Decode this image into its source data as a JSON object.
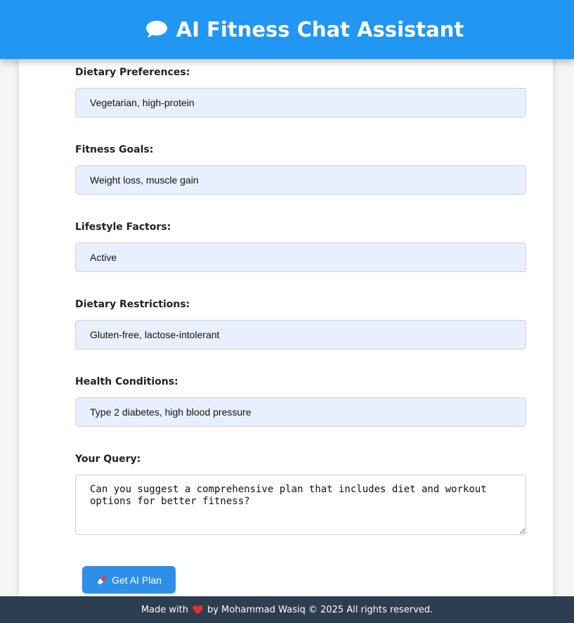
{
  "header": {
    "title": "AI Fitness Chat Assistant",
    "icon": "speech-bubble-icon",
    "background": "#2196f3"
  },
  "form": {
    "fields": [
      {
        "label": "Dietary Preferences:",
        "value": "Vegetarian, high-protein"
      },
      {
        "label": "Fitness Goals:",
        "value": "Weight loss, muscle gain"
      },
      {
        "label": "Lifestyle Factors:",
        "value": "Active"
      },
      {
        "label": "Dietary Restrictions:",
        "value": "Gluten-free, lactose-intolerant"
      },
      {
        "label": "Health Conditions:",
        "value": "Type 2 diabetes, high blood pressure"
      }
    ],
    "query": {
      "label": "Your Query:",
      "value": "Can you suggest a comprehensive plan that includes diet and workout options for better fitness?"
    },
    "submit_label": "Get AI Plan",
    "submit_icon": "pill-icon"
  },
  "footer": {
    "prefix": "Made with",
    "icon": "heart-icon",
    "suffix": "by Mohammad Wasiq © 2025 All rights reserved.",
    "background": "#2c3e50"
  }
}
